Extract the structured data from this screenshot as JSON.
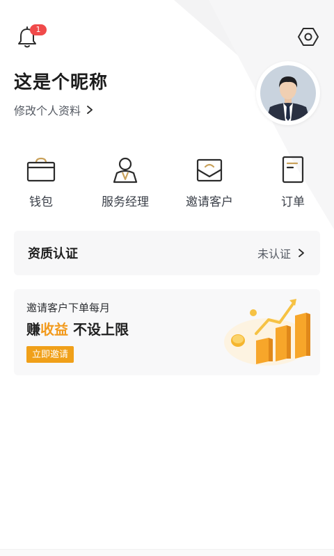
{
  "header": {
    "notification_count": "1",
    "nickname": "这是个昵称",
    "edit_profile_label": "修改个人资料"
  },
  "quick_actions": [
    {
      "label": "钱包",
      "icon": "wallet-icon"
    },
    {
      "label": "服务经理",
      "icon": "service-manager-icon"
    },
    {
      "label": "邀请客户",
      "icon": "invite-envelope-icon"
    },
    {
      "label": "订单",
      "icon": "order-icon"
    }
  ],
  "qualification": {
    "title": "资质认证",
    "status": "未认证"
  },
  "promo": {
    "subtitle": "邀请客户下单每月",
    "main_prefix": "赚",
    "main_highlight": "收益",
    "main_suffix": " 不设上限",
    "button_label": "立即邀请"
  },
  "colors": {
    "accent": "#f0a019",
    "badge": "#f04a4a",
    "text_primary": "#1f1f1f",
    "text_secondary": "#555a63"
  }
}
